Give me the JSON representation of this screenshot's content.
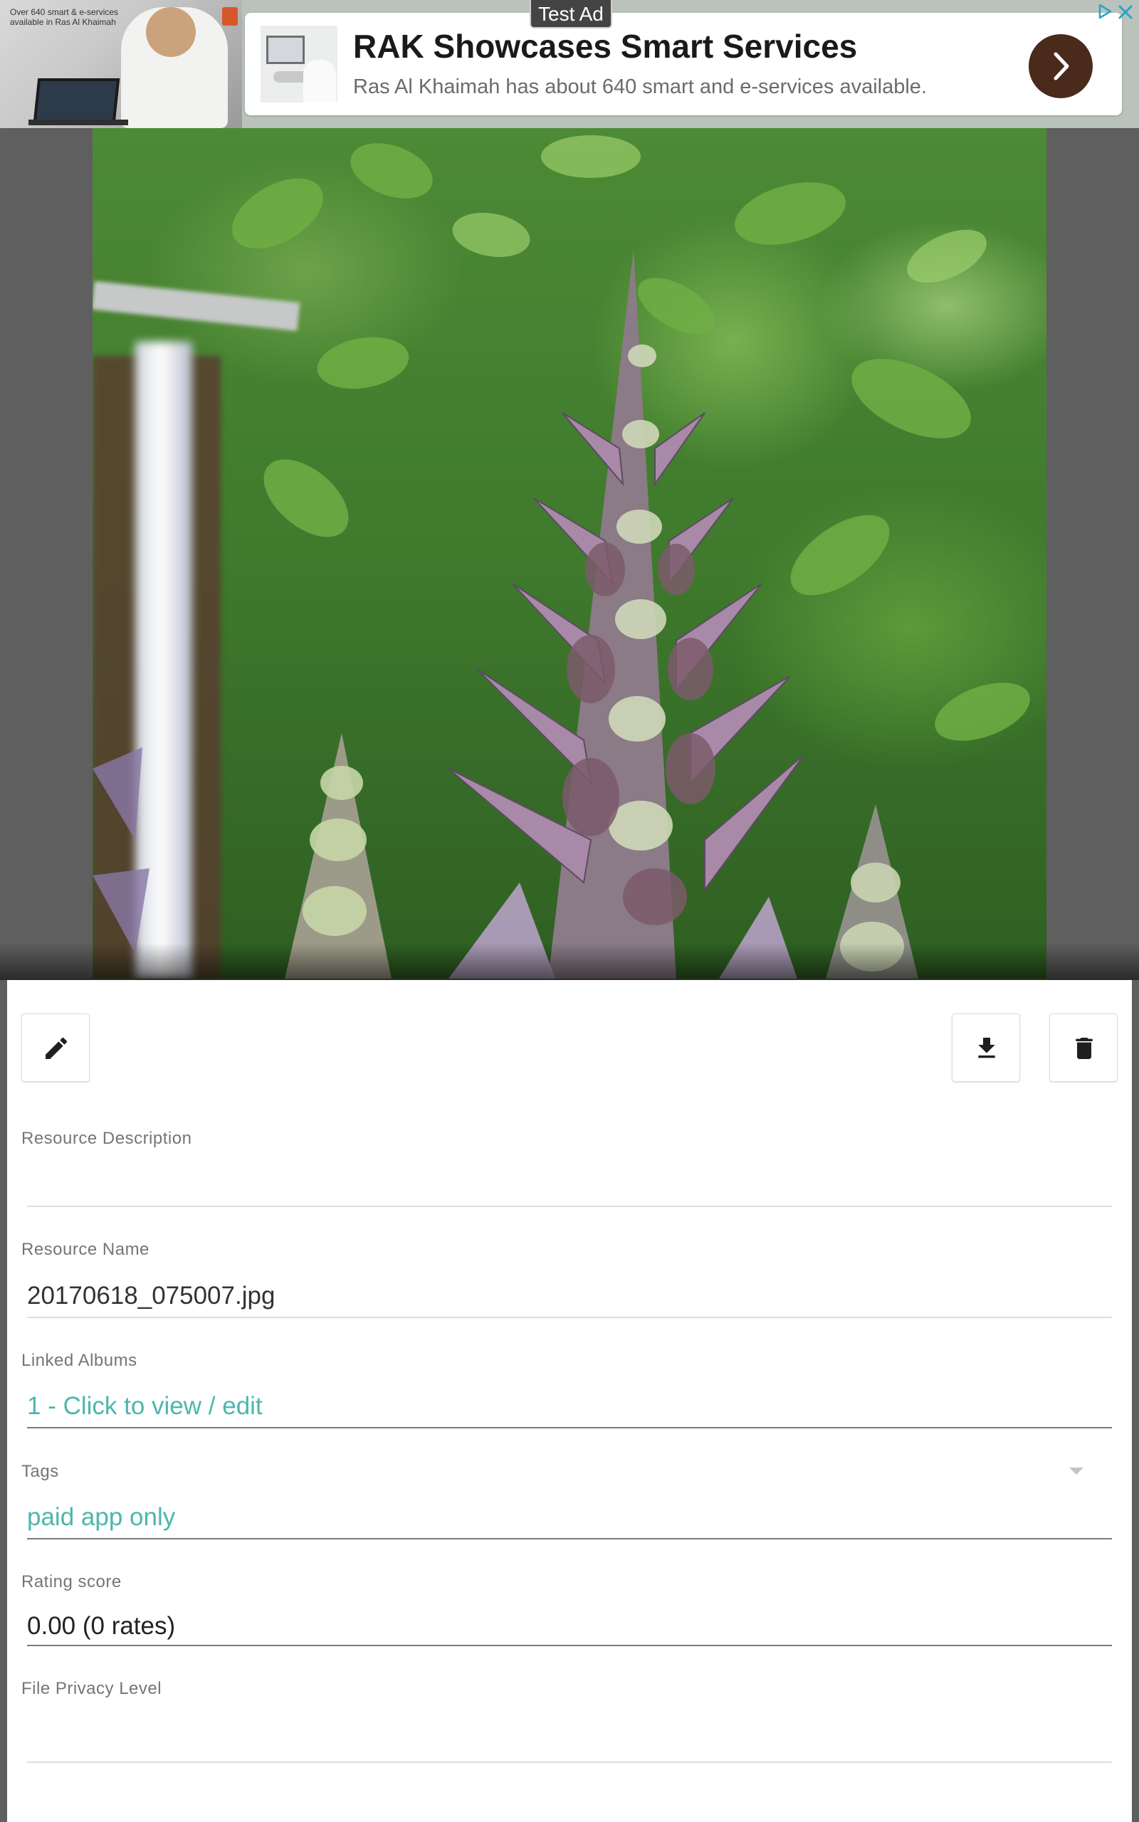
{
  "ad": {
    "badge": "Test Ad",
    "title": "RAK Showcases Smart Services",
    "description": "Ras Al Khaimah has about 640 smart and e-services available.",
    "image_caption": "Over 640 smart & e-services available in Ras Al Khaimah",
    "cta_icon": "chevron-right-icon",
    "close_icon": "close-icon",
    "adchoices_icon": "adchoices-icon"
  },
  "photo": {
    "subject": "photo of purple acanthus flower spikes"
  },
  "toolbar": {
    "edit_icon": "pencil-icon",
    "download_icon": "download-icon",
    "delete_icon": "trash-icon"
  },
  "fields": {
    "description": {
      "label": "Resource Description",
      "value": ""
    },
    "name": {
      "label": "Resource Name",
      "value": "20170618_075007.jpg"
    },
    "albums": {
      "label": "Linked Albums",
      "value": "1 - Click to view / edit"
    },
    "tags": {
      "label": "Tags",
      "value": "paid app only"
    },
    "rating": {
      "label": "Rating score",
      "value": "0.00 (0 rates)"
    },
    "privacy": {
      "label": "File Privacy Level",
      "value": ""
    }
  },
  "colors": {
    "accent": "#4db6ac",
    "ad_cta": "#4a2a1b",
    "backdrop": "#5f5f5f"
  }
}
